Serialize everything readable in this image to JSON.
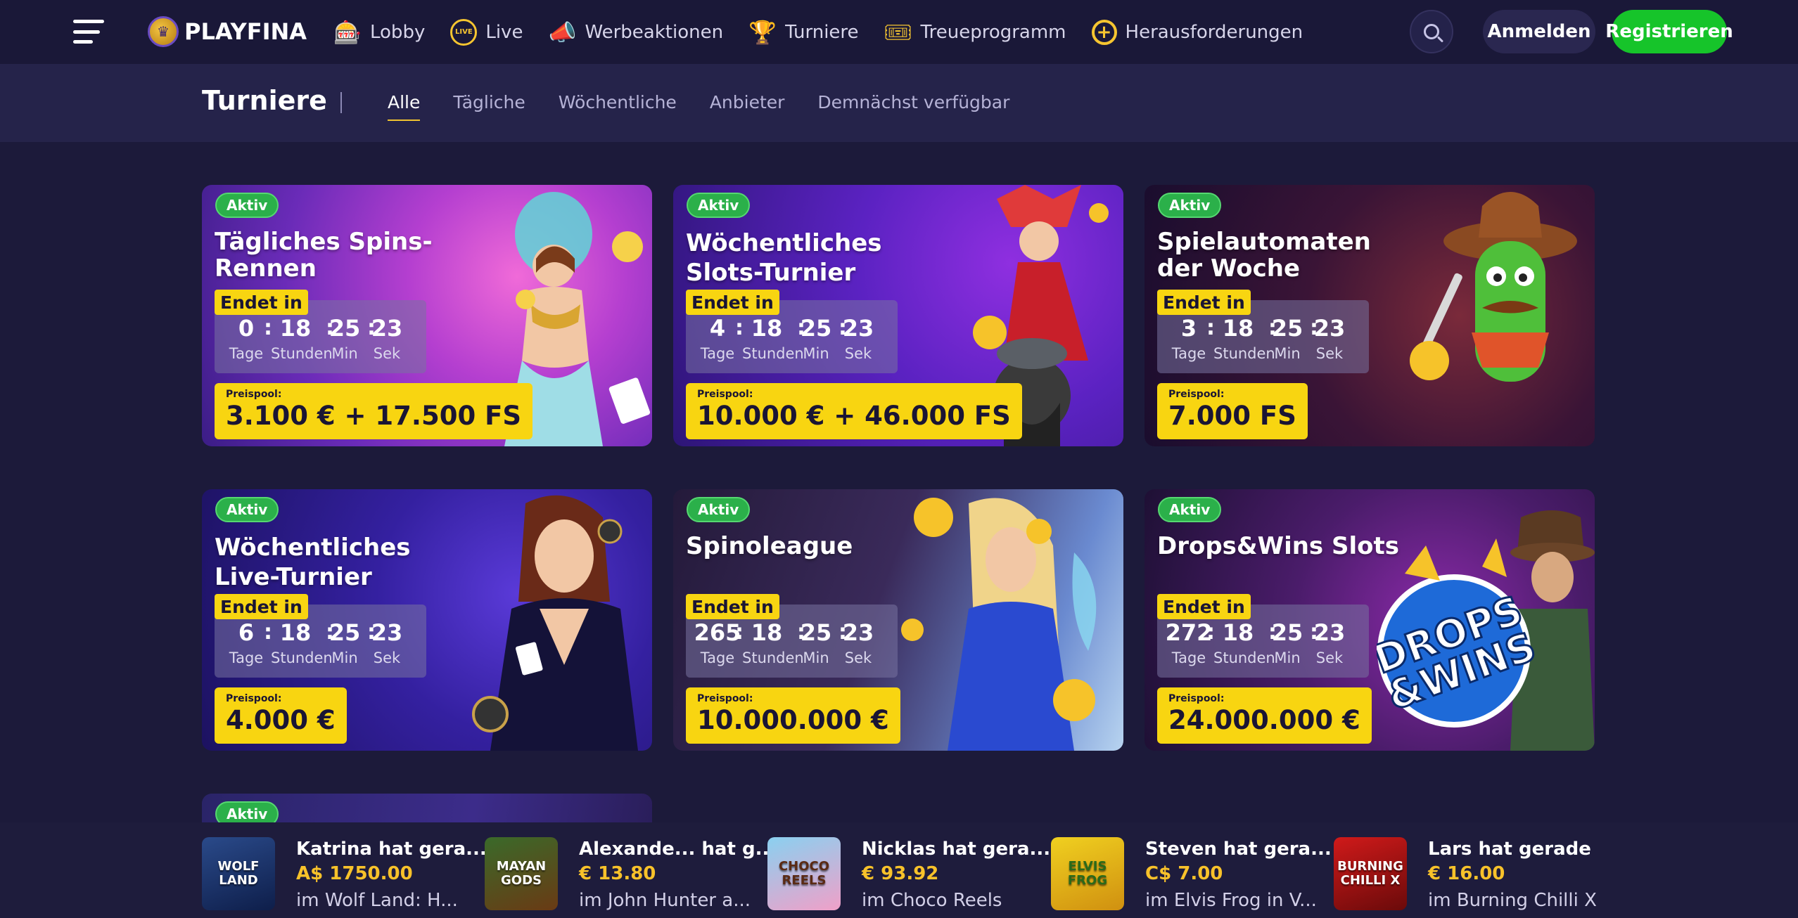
{
  "brand": {
    "logo_text": "PLAYFINA"
  },
  "nav": {
    "items": [
      {
        "label": "Lobby",
        "icon": "slot-machine-icon"
      },
      {
        "label": "Live",
        "icon": "live-icon"
      },
      {
        "label": "Werbeaktionen",
        "icon": "megaphone-icon"
      },
      {
        "label": "Turniere",
        "icon": "trophy-icon"
      },
      {
        "label": "Treueprogramm",
        "icon": "ticket-icon"
      },
      {
        "label": "Herausforderungen",
        "icon": "target-icon"
      }
    ],
    "login_label": "Anmelden",
    "register_label": "Registrieren"
  },
  "subheader": {
    "title": "Turniere",
    "tabs": [
      {
        "label": "Alle",
        "active": true
      },
      {
        "label": "Tägliche",
        "active": false
      },
      {
        "label": "Wöchentliche",
        "active": false
      },
      {
        "label": "Anbieter",
        "active": false
      },
      {
        "label": "Demnächst verfügbar",
        "active": false
      }
    ]
  },
  "tournaments": [
    {
      "status": "Aktiv",
      "title": "Tägliches Spins-Rennen",
      "ends_label": "Endet in",
      "timer": {
        "days": "0",
        "hours": "18",
        "minutes": "25",
        "seconds": "23"
      },
      "timer_labels": {
        "days": "Tage",
        "hours": "Stunden",
        "minutes": "Min",
        "seconds": "Sek"
      },
      "prize_label": "Preispool:",
      "prize_value": "3.100 € + 17.500 FS"
    },
    {
      "status": "Aktiv",
      "title": "Wöchentliches Slots-Turnier",
      "ends_label": "Endet in",
      "timer": {
        "days": "4",
        "hours": "18",
        "minutes": "25",
        "seconds": "23"
      },
      "timer_labels": {
        "days": "Tage",
        "hours": "Stunden",
        "minutes": "Min",
        "seconds": "Sek"
      },
      "prize_label": "Preispool:",
      "prize_value": "10.000 € + 46.000 FS"
    },
    {
      "status": "Aktiv",
      "title": "Spielautomaten der Woche",
      "ends_label": "Endet in",
      "timer": {
        "days": "3",
        "hours": "18",
        "minutes": "25",
        "seconds": "23"
      },
      "timer_labels": {
        "days": "Tage",
        "hours": "Stunden",
        "minutes": "Min",
        "seconds": "Sek"
      },
      "prize_label": "Preispool:",
      "prize_value": "7.000 FS"
    },
    {
      "status": "Aktiv",
      "title": "Wöchentliches Live-Turnier",
      "ends_label": "Endet in",
      "timer": {
        "days": "6",
        "hours": "18",
        "minutes": "25",
        "seconds": "23"
      },
      "timer_labels": {
        "days": "Tage",
        "hours": "Stunden",
        "minutes": "Min",
        "seconds": "Sek"
      },
      "prize_label": "Preispool:",
      "prize_value": "4.000 €"
    },
    {
      "status": "Aktiv",
      "title": "Spinoleague",
      "ends_label": "Endet in",
      "timer": {
        "days": "265",
        "hours": "18",
        "minutes": "25",
        "seconds": "23"
      },
      "timer_labels": {
        "days": "Tage",
        "hours": "Stunden",
        "minutes": "Min",
        "seconds": "Sek"
      },
      "prize_label": "Preispool:",
      "prize_value": "10.000.000 €"
    },
    {
      "status": "Aktiv",
      "title": "Drops&Wins Slots",
      "ends_label": "Endet in",
      "timer": {
        "days": "272",
        "hours": "18",
        "minutes": "25",
        "seconds": "23"
      },
      "timer_labels": {
        "days": "Tage",
        "hours": "Stunden",
        "minutes": "Min",
        "seconds": "Sek"
      },
      "prize_label": "Preispool:",
      "prize_value": "24.000.000 €"
    },
    {
      "status": "Aktiv"
    }
  ],
  "winners": [
    {
      "name": "Katrina hat gera...",
      "amount": "A$ 1750.00",
      "game": "im Wolf Land: H...",
      "thumb_text": "WOLF LAND"
    },
    {
      "name": "Alexande... hat g...",
      "amount": "€ 13.80",
      "game": "im John Hunter a...",
      "thumb_text": "MAYAN GODS"
    },
    {
      "name": "Nicklas hat gera...",
      "amount": "€ 93.92",
      "game": "im Choco Reels",
      "thumb_text": "CHOCO REELS"
    },
    {
      "name": "Steven hat gera...",
      "amount": "C$ 7.00",
      "game": "im Elvis Frog in V...",
      "thumb_text": "ELVIS FROG"
    },
    {
      "name": "Lars hat gerade",
      "amount": "€ 16.00",
      "game": "im Burning Chilli X",
      "thumb_text": "BURNING CHILLI X"
    }
  ],
  "colors": {
    "accent_yellow": "#f8d511",
    "active_green": "#2bb04a",
    "register_green": "#16c42a",
    "background": "#1c1a3a"
  }
}
